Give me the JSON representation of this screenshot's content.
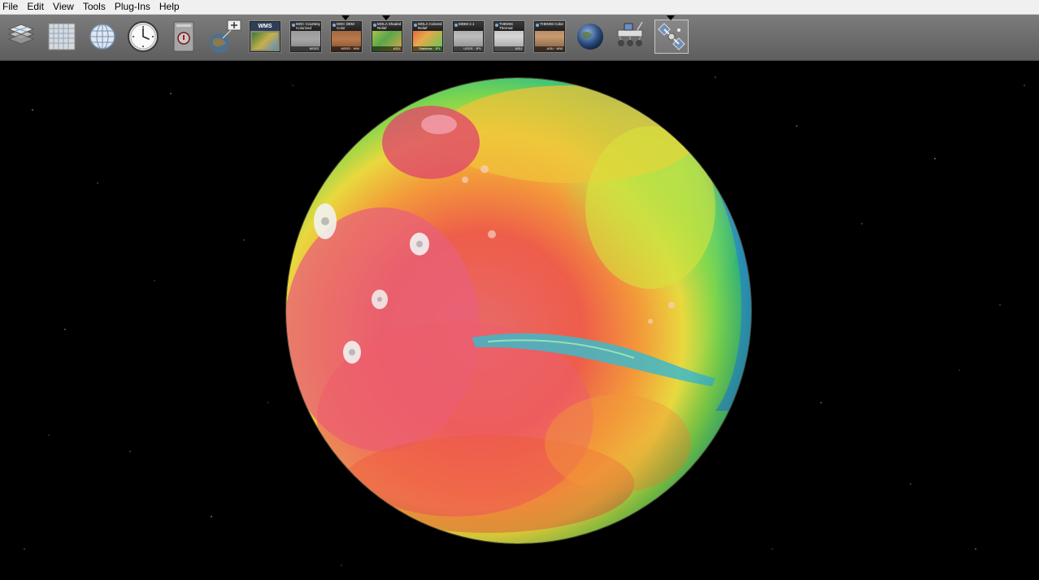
{
  "menu": [
    "File",
    "Edit",
    "View",
    "Tools",
    "Plug-Ins",
    "Help"
  ],
  "toolbar": {
    "items": [
      {
        "icon": "layers-icon"
      },
      {
        "icon": "grid-icon"
      },
      {
        "icon": "globe-graticule-icon"
      },
      {
        "icon": "clock-icon"
      },
      {
        "icon": "info-card-icon"
      },
      {
        "icon": "add-layer-icon"
      },
      {
        "icon": "wms-icon",
        "label": "WMS"
      },
      {
        "icon": "layer-tile-moc-courtesy-icon",
        "caption": "MOC Courtesy Colorized",
        "foot": "MSSS"
      },
      {
        "icon": "layer-tile-moc-dem-icon",
        "caption": "MOC DEM Color",
        "foot": "MSSS · WW"
      },
      {
        "icon": "layer-tile-mola-shaded-icon",
        "caption": "MOLA Shaded Relief",
        "foot": "ASU"
      },
      {
        "icon": "layer-tile-mola-colored-icon",
        "caption": "MOLA Colored Relief",
        "foot": "Stateless · JPL"
      },
      {
        "icon": "layer-tile-mdim-icon",
        "caption": "MDIM 2.1",
        "foot": "USGS · JPL"
      },
      {
        "icon": "layer-tile-themis-icon",
        "caption": "THEMIS Thermal",
        "foot": "ASU"
      },
      {
        "icon": "layer-tile-themis-color-icon",
        "caption": "THEMIS Color",
        "foot": "ASU · WW"
      },
      {
        "icon": "planet-icon"
      },
      {
        "icon": "rover-icon"
      },
      {
        "icon": "spacecraft-icon"
      }
    ]
  },
  "colors": {
    "menubar_bg": "#f0f0f0",
    "toolbar_bg": "#6c6c6c",
    "space_bg": "#000000"
  },
  "globe": {
    "body": "Mars",
    "layer": "MOLA Colored Relief"
  }
}
